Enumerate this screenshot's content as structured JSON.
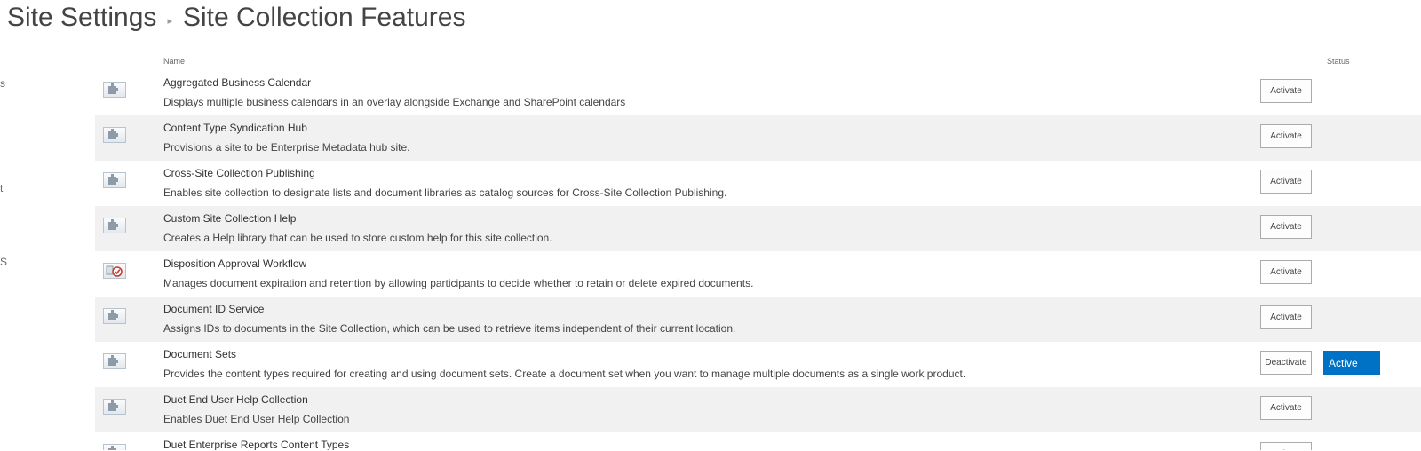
{
  "breadcrumb": {
    "parent": "Site Settings",
    "current": "Site Collection Features"
  },
  "left_nav_fragments": [
    "s",
    "t",
    "S"
  ],
  "columns": {
    "name": "Name",
    "status": "Status"
  },
  "features": [
    {
      "name": "Aggregated Business Calendar",
      "description": "Displays multiple business calendars in an overlay alongside Exchange and SharePoint calendars",
      "icon": "feature-puzzle-icon",
      "button": "Activate",
      "status": ""
    },
    {
      "name": "Content Type Syndication Hub",
      "description": "Provisions a site to be Enterprise Metadata hub site.",
      "icon": "feature-puzzle-icon",
      "button": "Activate",
      "status": ""
    },
    {
      "name": "Cross-Site Collection Publishing",
      "description": "Enables site collection to designate lists and document libraries as catalog sources for Cross-Site Collection Publishing.",
      "icon": "feature-puzzle-icon",
      "button": "Activate",
      "status": ""
    },
    {
      "name": "Custom Site Collection Help",
      "description": "Creates a Help library that can be used to store custom help for this site collection.",
      "icon": "feature-puzzle-icon",
      "button": "Activate",
      "status": ""
    },
    {
      "name": "Disposition Approval Workflow",
      "description": "Manages document expiration and retention by allowing participants to decide whether to retain or delete expired documents.",
      "icon": "workflow-check-icon",
      "button": "Activate",
      "status": ""
    },
    {
      "name": "Document ID Service",
      "description": "Assigns IDs to documents in the Site Collection, which can be used to retrieve items independent of their current location.",
      "icon": "feature-puzzle-icon",
      "button": "Activate",
      "status": ""
    },
    {
      "name": "Document Sets",
      "description": "Provides the content types required for creating and using document sets. Create a document set when you want to manage multiple documents as a single work product.",
      "icon": "feature-puzzle-icon",
      "button": "Deactivate",
      "status": "Active"
    },
    {
      "name": "Duet End User Help Collection",
      "description": "Enables Duet End User Help Collection",
      "icon": "feature-puzzle-icon",
      "button": "Activate",
      "status": ""
    },
    {
      "name": "Duet Enterprise Reports Content Types",
      "description": "",
      "icon": "feature-puzzle-icon",
      "button": "Activate",
      "status": ""
    }
  ],
  "colors": {
    "active_badge": "#0072c6",
    "alt_row": "#f1f1f1"
  }
}
